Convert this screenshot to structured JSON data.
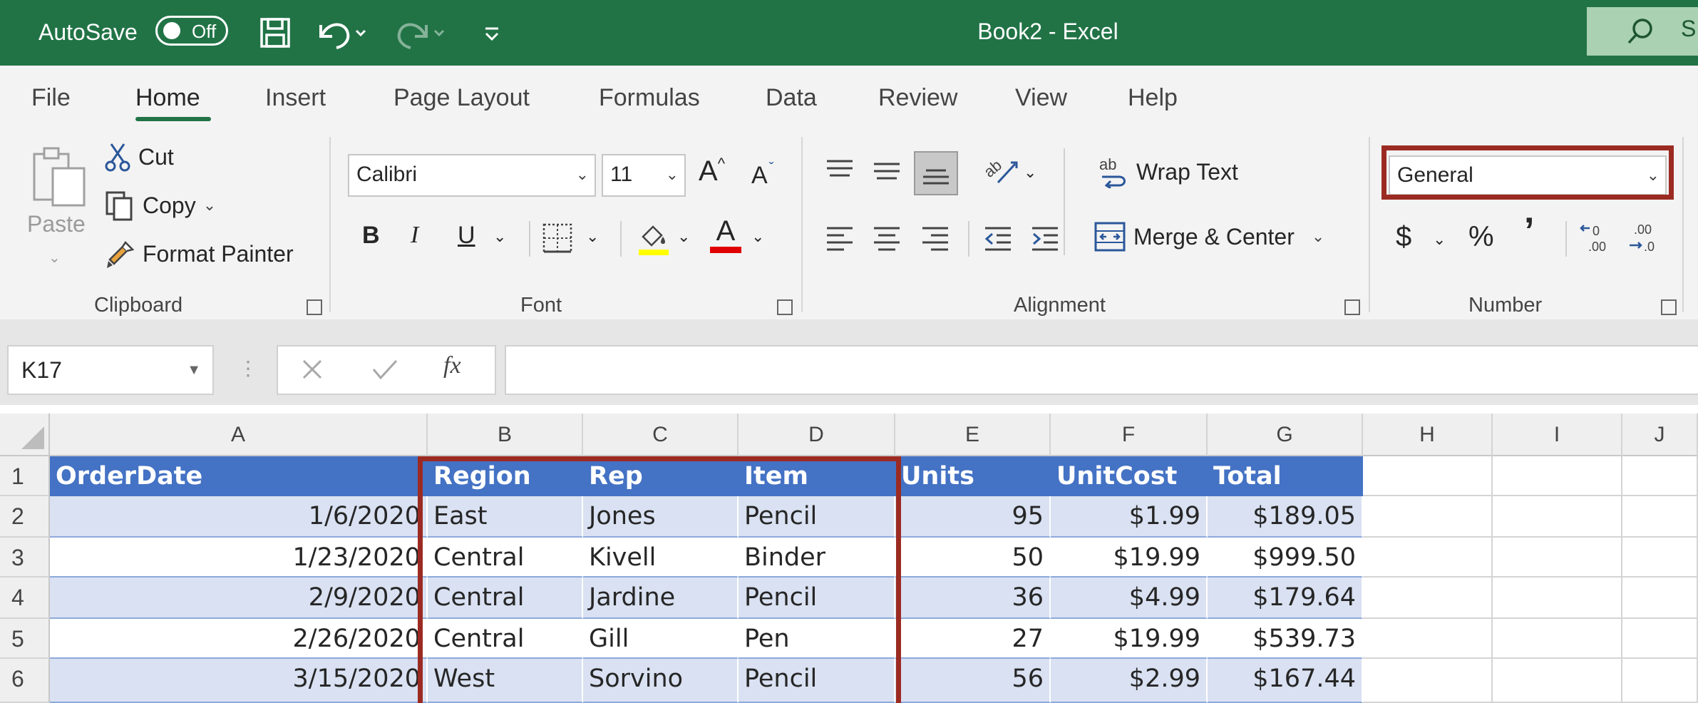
{
  "titlebar": {
    "autosave_label": "AutoSave",
    "autosave_state": "Off",
    "document_title": "Book2  -  Excel",
    "search_placeholder": "S"
  },
  "tabs": [
    "File",
    "Home",
    "Insert",
    "Page Layout",
    "Formulas",
    "Data",
    "Review",
    "View",
    "Help"
  ],
  "active_tab": "Home",
  "ribbon": {
    "clipboard": {
      "paste": "Paste",
      "cut": "Cut",
      "copy": "Copy",
      "format_painter": "Format Painter",
      "group_label": "Clipboard"
    },
    "font": {
      "font_name": "Calibri",
      "font_size": "11",
      "bold": "B",
      "italic": "I",
      "underline": "U",
      "font_color_glyph": "A",
      "group_label": "Font"
    },
    "alignment": {
      "wrap_text": "Wrap Text",
      "merge_center": "Merge & Center",
      "group_label": "Alignment"
    },
    "number": {
      "format": "General",
      "currency": "$",
      "percent": "%",
      "comma": "’",
      "group_label": "Number"
    }
  },
  "formula_bar": {
    "name_box": "K17",
    "fx": "fx",
    "value": ""
  },
  "grid": {
    "columns": [
      "A",
      "B",
      "C",
      "D",
      "E",
      "F",
      "G",
      "H",
      "I",
      "J"
    ],
    "rows": [
      "1",
      "2",
      "3",
      "4",
      "5",
      "6"
    ],
    "header": [
      "OrderDate",
      "Region",
      "Rep",
      "Item",
      "Units",
      "UnitCost",
      "Total"
    ],
    "data": [
      [
        "1/6/2020",
        "East",
        "Jones",
        "Pencil",
        "95",
        "$1.99",
        "$189.05"
      ],
      [
        "1/23/2020",
        "Central",
        "Kivell",
        "Binder",
        "50",
        "$19.99",
        "$999.50"
      ],
      [
        "2/9/2020",
        "Central",
        "Jardine",
        "Pencil",
        "36",
        "$4.99",
        "$179.64"
      ],
      [
        "2/26/2020",
        "Central",
        "Gill",
        "Pen",
        "27",
        "$19.99",
        "$539.73"
      ],
      [
        "3/15/2020",
        "West",
        "Sorvino",
        "Pencil",
        "56",
        "$2.99",
        "$167.44"
      ]
    ]
  },
  "colors": {
    "excel_green": "#217346",
    "table_header": "#4472c4",
    "band_row": "#d9e1f2",
    "highlight_box": "#9b2b22"
  }
}
